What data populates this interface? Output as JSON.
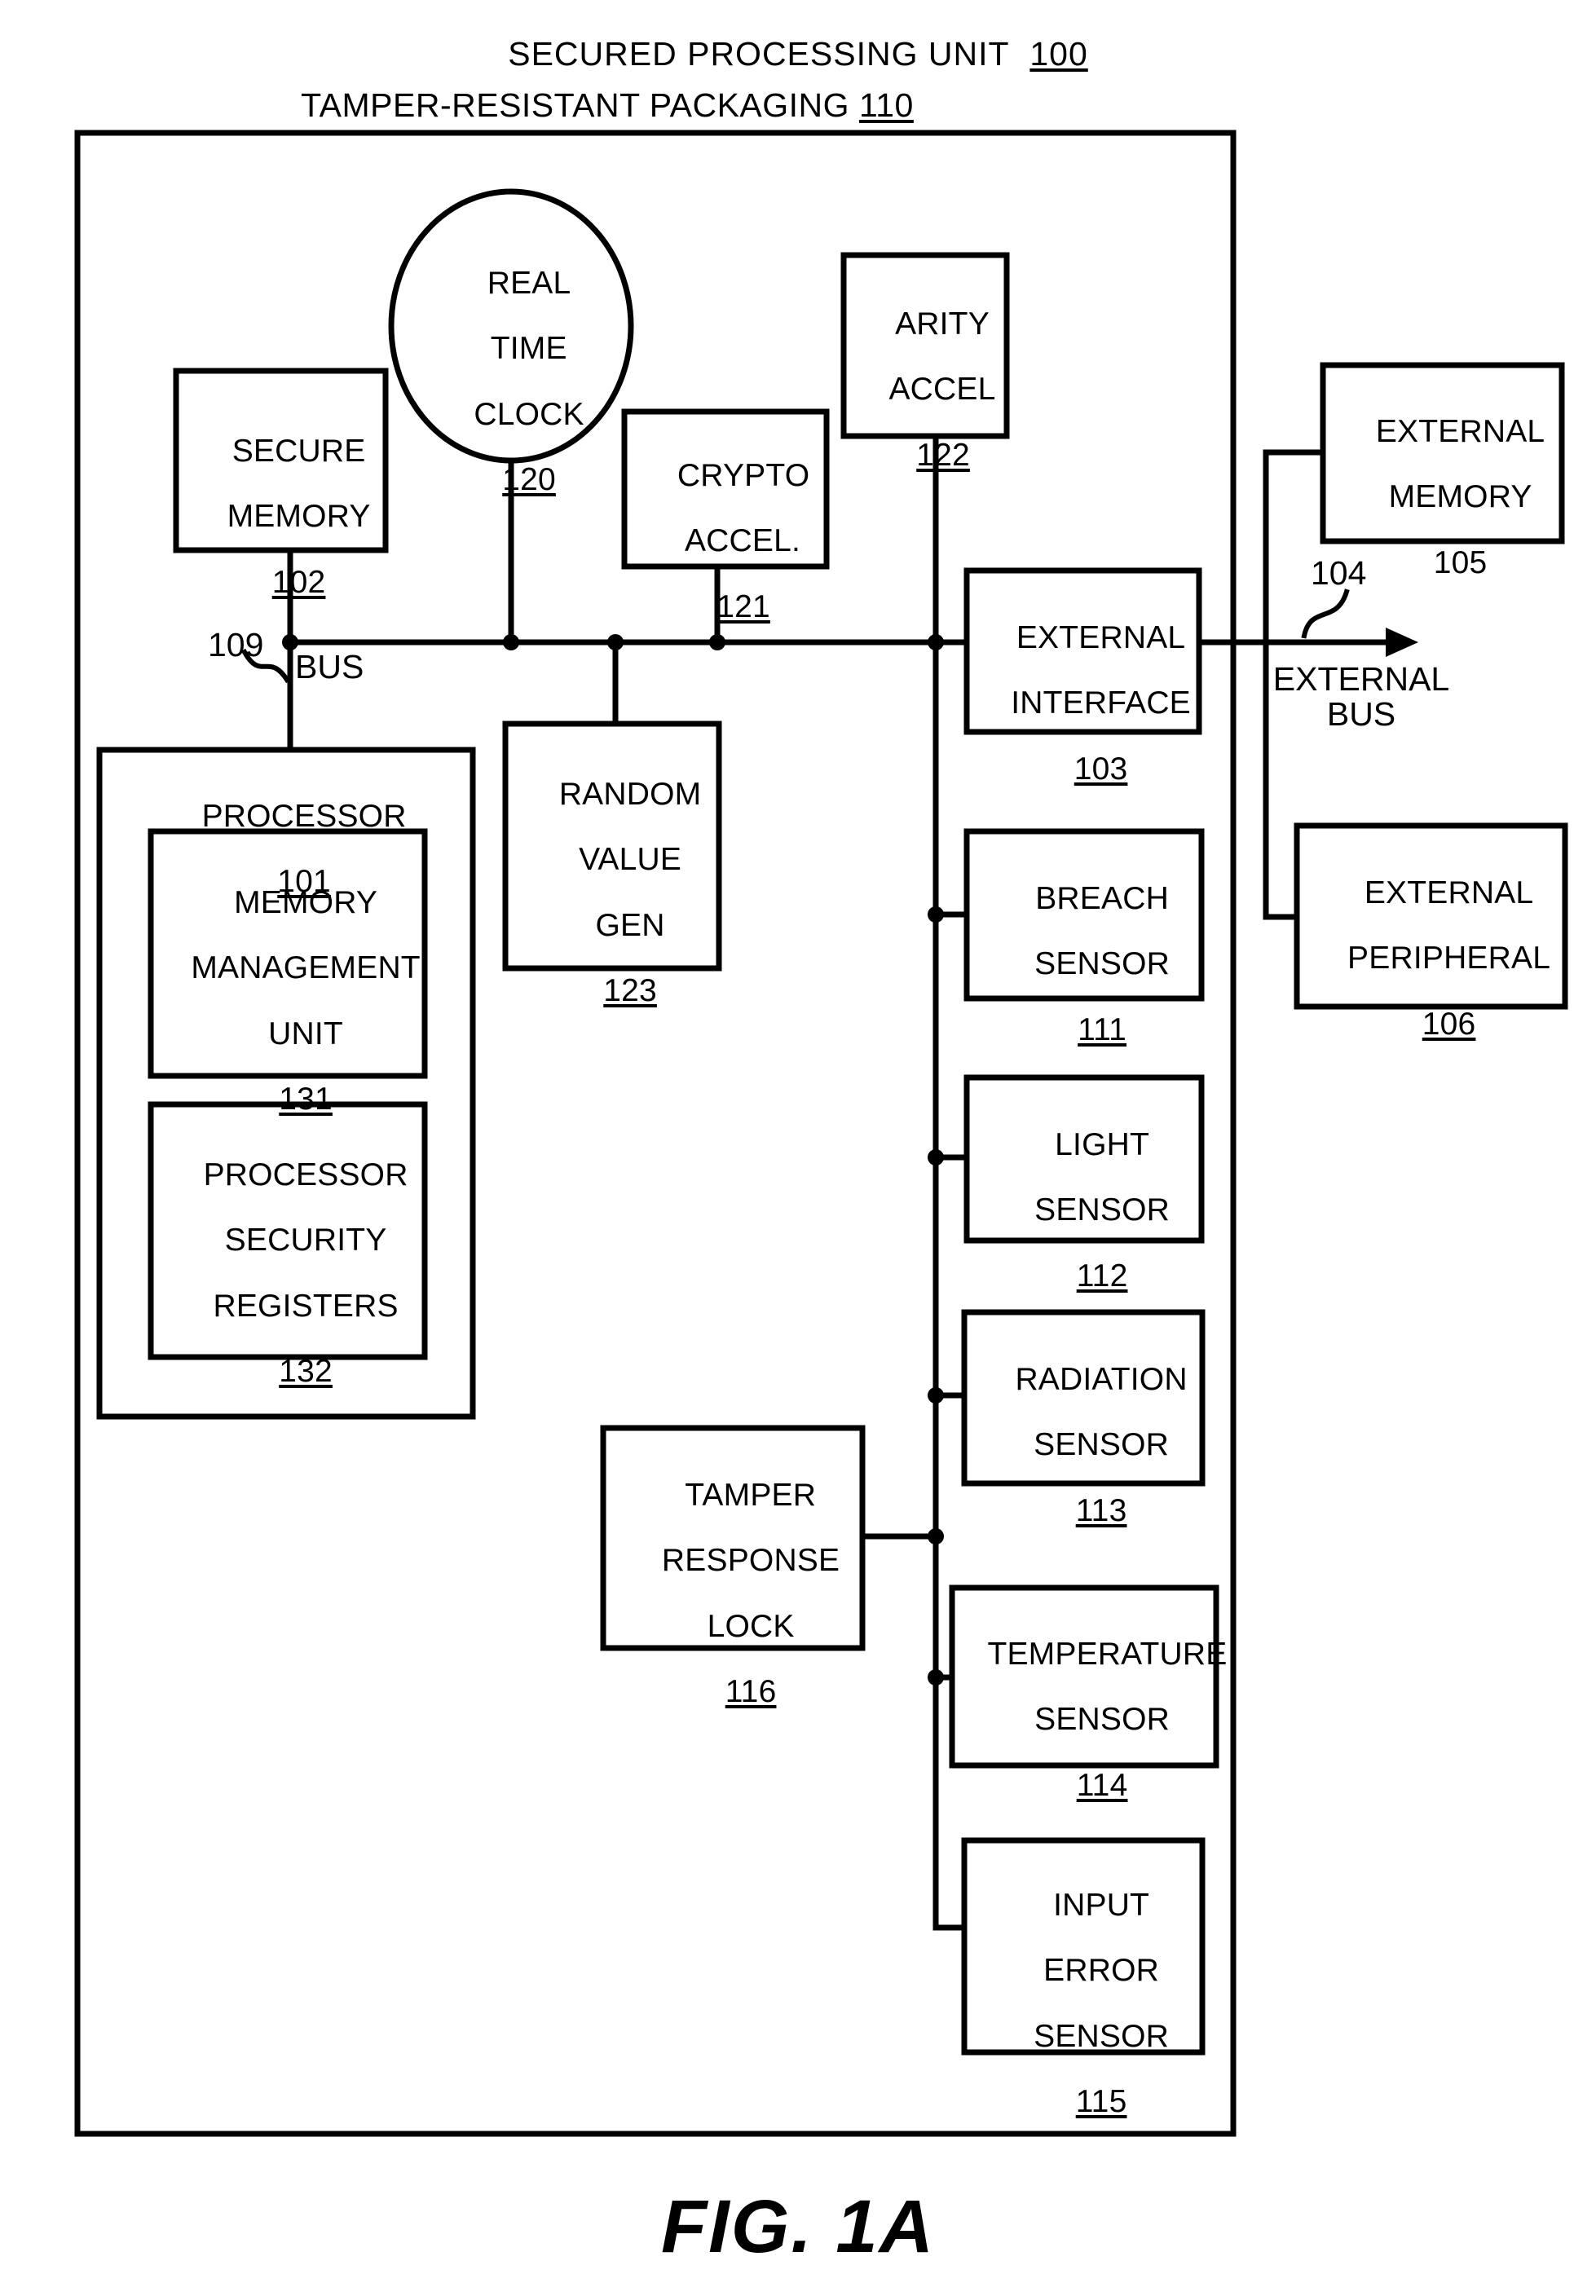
{
  "figure": {
    "caption": "FIG. 1A",
    "title": "SECURED PROCESSING UNIT",
    "title_ref": "100",
    "packaging_label": "TAMPER-RESISTANT PACKAGING",
    "packaging_ref": "110"
  },
  "labels": {
    "bus": "BUS",
    "bus_ref": "109",
    "external_bus_line1": "EXTERNAL",
    "external_bus_line2": "BUS",
    "external_bus_ref": "104"
  },
  "blocks": {
    "secure_memory": {
      "line1": "SECURE",
      "line2": "MEMORY",
      "ref": "102"
    },
    "real_time_clock": {
      "line1": "REAL",
      "line2": "TIME",
      "line3": "CLOCK",
      "ref": "120"
    },
    "crypto_accel": {
      "line1": "CRYPTO",
      "line2": "ACCEL.",
      "ref": "121"
    },
    "arity_accel": {
      "line1": "ARITY",
      "line2": "ACCEL",
      "ref": "122"
    },
    "external_interface": {
      "line1": "EXTERNAL",
      "line2": "INTERFACE",
      "ref": "103"
    },
    "external_memory": {
      "line1": "EXTERNAL",
      "line2": "MEMORY",
      "ref": "105"
    },
    "external_peripheral": {
      "line1": "EXTERNAL",
      "line2": "PERIPHERAL",
      "ref": "106"
    },
    "processor": {
      "line1": "PROCESSOR",
      "ref": "101"
    },
    "mmu": {
      "line1": "MEMORY",
      "line2": "MANAGEMENT",
      "line3": "UNIT",
      "ref": "131"
    },
    "security_registers": {
      "line1": "PROCESSOR",
      "line2": "SECURITY",
      "line3": "REGISTERS",
      "ref": "132"
    },
    "random_value_gen": {
      "line1": "RANDOM",
      "line2": "VALUE",
      "line3": "GEN",
      "ref": "123"
    },
    "breach_sensor": {
      "line1": "BREACH",
      "line2": "SENSOR",
      "ref": "111"
    },
    "light_sensor": {
      "line1": "LIGHT",
      "line2": "SENSOR",
      "ref": "112"
    },
    "radiation_sensor": {
      "line1": "RADIATION",
      "line2": "SENSOR",
      "ref": "113"
    },
    "temperature_sensor": {
      "line1": "TEMPERATURE",
      "line2": "SENSOR",
      "ref": "114"
    },
    "input_error_sensor": {
      "line1": "INPUT",
      "line2": "ERROR",
      "line3": "SENSOR",
      "ref": "115"
    },
    "tamper_response_lock": {
      "line1": "TAMPER",
      "line2": "RESPONSE",
      "line3": "LOCK",
      "ref": "116"
    }
  },
  "colors": {
    "ink": "#000000",
    "paper": "#ffffff"
  }
}
